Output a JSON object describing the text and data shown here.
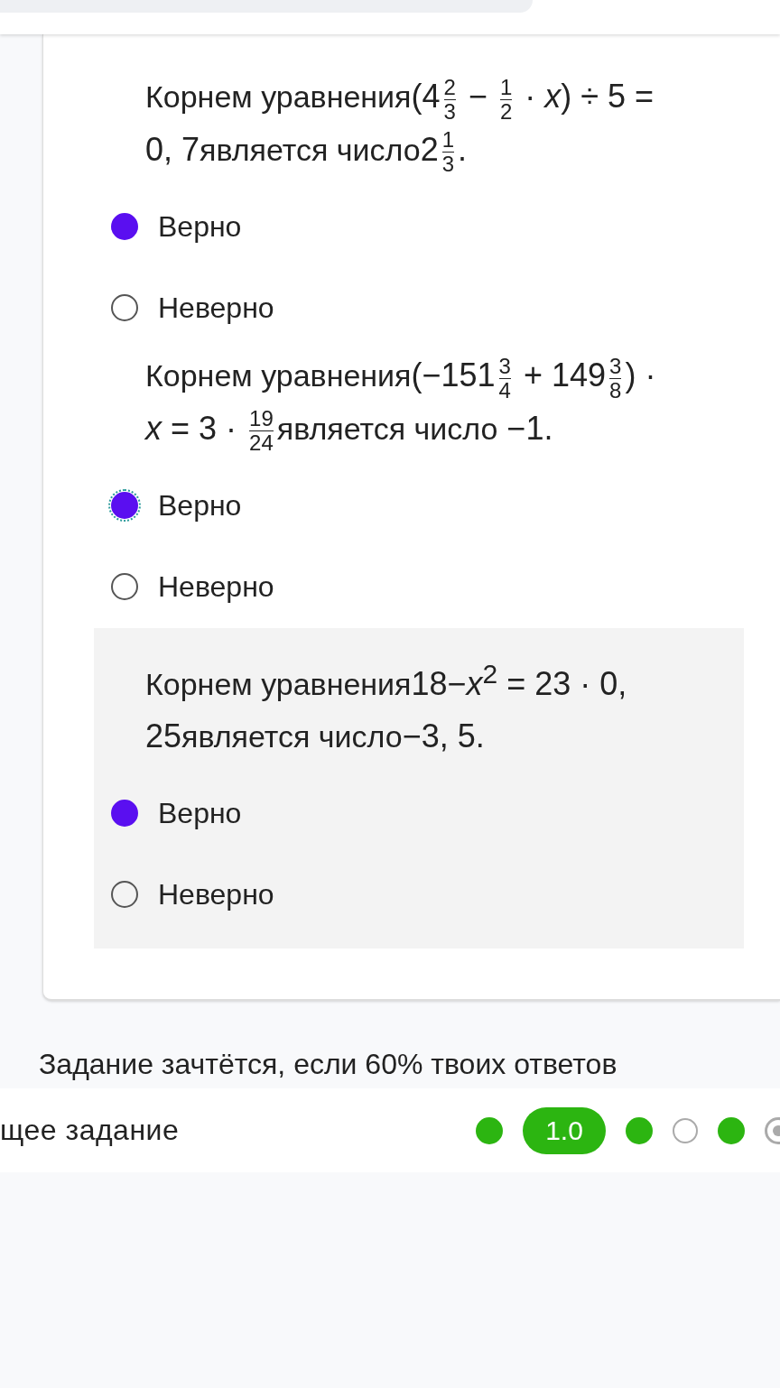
{
  "questions": [
    {
      "shaded": false,
      "statement": [
        {
          "kind": "text",
          "text": "Корнем уравнения"
        },
        {
          "kind": "math",
          "text": "(4"
        },
        {
          "kind": "frac",
          "num": "2",
          "den": "3"
        },
        {
          "kind": "math",
          "text": " − "
        },
        {
          "kind": "frac",
          "num": "1",
          "den": "2"
        },
        {
          "kind": "math",
          "text": " · *x*) ÷ 5 = 0, 7"
        },
        {
          "kind": "text",
          "text": "является число"
        },
        {
          "kind": "math",
          "text": "2"
        },
        {
          "kind": "frac",
          "num": "1",
          "den": "3"
        },
        {
          "kind": "math",
          "text": "."
        }
      ],
      "options": [
        {
          "label": "Верно",
          "selected": true,
          "focused": false
        },
        {
          "label": "Неверно",
          "selected": false,
          "focused": false
        }
      ]
    },
    {
      "shaded": false,
      "statement": [
        {
          "kind": "text",
          "text": "Корнем уравнения"
        },
        {
          "kind": "math",
          "text": "(−151"
        },
        {
          "kind": "frac",
          "num": "3",
          "den": "4"
        },
        {
          "kind": "math",
          "text": " + 149"
        },
        {
          "kind": "frac",
          "num": "3",
          "den": "8"
        },
        {
          "kind": "math",
          "text": ") · *x* = 3 · "
        },
        {
          "kind": "frac",
          "num": "19",
          "den": "24"
        },
        {
          "kind": "text",
          "text": "является число"
        },
        {
          "kind": "math",
          "text": " −1."
        }
      ],
      "options": [
        {
          "label": "Верно",
          "selected": true,
          "focused": true
        },
        {
          "label": "Неверно",
          "selected": false,
          "focused": false
        }
      ]
    },
    {
      "shaded": true,
      "statement": [
        {
          "kind": "text",
          "text": "Корнем уравнения"
        },
        {
          "kind": "math",
          "text": "18−*x*$^{2}$ = 23 · 0, 25"
        },
        {
          "kind": "text",
          "text": "является число"
        },
        {
          "kind": "math",
          "text": "−3, 5."
        }
      ],
      "options": [
        {
          "label": "Верно",
          "selected": true,
          "focused": false
        },
        {
          "label": "Неверно",
          "selected": false,
          "focused": false
        }
      ]
    }
  ],
  "note": "Задание зачтётся, если 60% твоих ответов",
  "footer": {
    "next_label": "щее задание",
    "steps": [
      {
        "kind": "done"
      },
      {
        "kind": "current",
        "label": "1.0"
      },
      {
        "kind": "done"
      },
      {
        "kind": "empty"
      },
      {
        "kind": "done"
      },
      {
        "kind": "ring"
      }
    ]
  }
}
